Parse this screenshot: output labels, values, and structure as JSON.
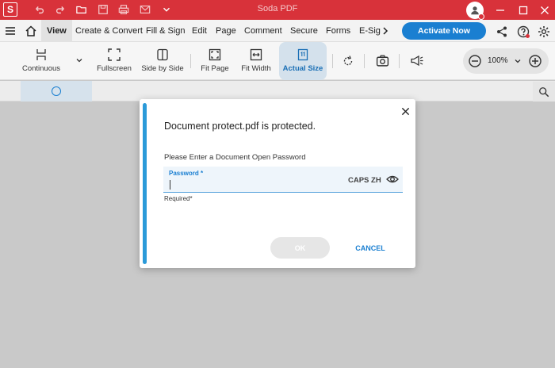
{
  "titlebar": {
    "app_title": "Soda PDF",
    "logo_letter": "S",
    "icons": [
      "undo-icon",
      "redo-icon",
      "open-folder-icon",
      "save-icon",
      "print-icon",
      "mail-icon",
      "chevron-down-icon"
    ],
    "window_controls": [
      "minimize-icon",
      "maximize-icon",
      "close-icon"
    ]
  },
  "menubar": {
    "items": [
      "View",
      "Create & Convert",
      "Fill & Sign",
      "Edit",
      "Page",
      "Comment",
      "Secure",
      "Forms",
      "E-Sig"
    ],
    "active": "View",
    "activate_label": "Activate Now"
  },
  "toolbar": {
    "tools": [
      "Continuous",
      "Fullscreen",
      "Side by Side",
      "Fit Page",
      "Fit Width",
      "Actual Size"
    ],
    "active_tool": "Actual Size",
    "zoom_value": "100%"
  },
  "dialog": {
    "heading": "Document protect.pdf is protected.",
    "prompt": "Please Enter a Document Open Password",
    "field_label": "Password *",
    "field_value": "",
    "caps_indicator": "CAPS ZH",
    "helper_text": "Required*",
    "ok_label": "OK",
    "cancel_label": "CANCEL"
  },
  "colors": {
    "brand_red": "#d8323a",
    "accent_blue": "#1a7fd1",
    "dialog_accent": "#2b9ad9"
  }
}
